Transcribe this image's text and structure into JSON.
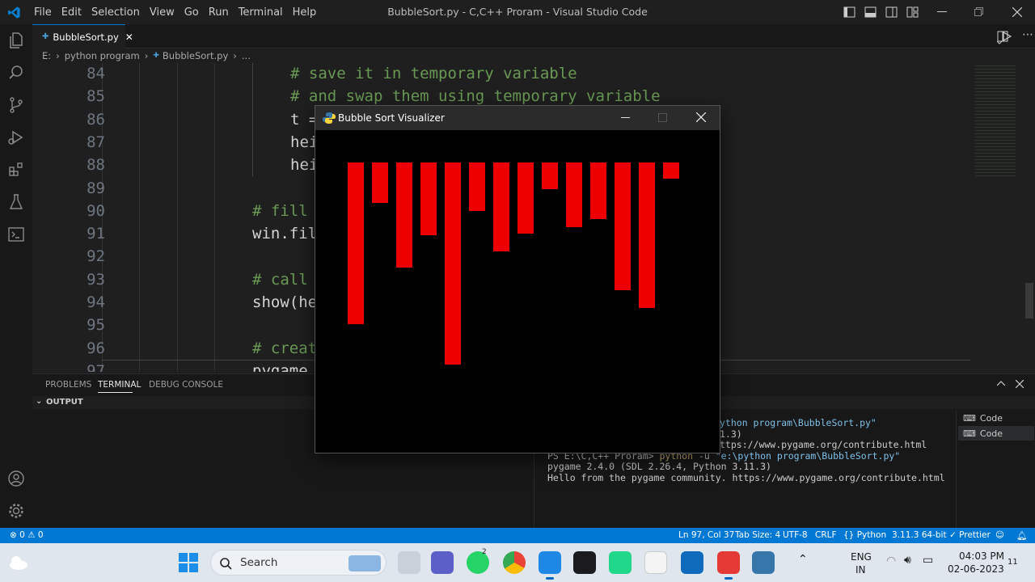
{
  "window": {
    "menu": [
      "File",
      "Edit",
      "Selection",
      "View",
      "Go",
      "Run",
      "Terminal",
      "Help"
    ],
    "title": "BubbleSort.py - C,C++ Proram - Visual Studio Code"
  },
  "tab": {
    "label": "BubbleSort.py"
  },
  "breadcrumb": {
    "drive": "E:",
    "folder": "python program",
    "file": "BubbleSort.py",
    "more": "..."
  },
  "editor": {
    "lines": [
      {
        "num": "84",
        "text": "# save it in temporary variable",
        "comment": true
      },
      {
        "num": "85",
        "text": "# and swap them using temporary variable",
        "comment": true
      },
      {
        "num": "86",
        "text": "t =",
        "comment": false
      },
      {
        "num": "87",
        "text": "hei",
        "comment": false
      },
      {
        "num": "88",
        "text": "hei",
        "comment": false
      },
      {
        "num": "89",
        "text": "",
        "comment": false
      },
      {
        "num": "90",
        "text": "# fill",
        "comment": true
      },
      {
        "num": "91",
        "text": "win.fil",
        "comment": false
      },
      {
        "num": "92",
        "text": "",
        "comment": false
      },
      {
        "num": "93",
        "text": "# call",
        "comment": true
      },
      {
        "num": "94",
        "text": "show(he",
        "comment": false
      },
      {
        "num": "95",
        "text": "",
        "comment": false
      },
      {
        "num": "96",
        "text": "# creat",
        "comment": true
      },
      {
        "num": "97",
        "text": "pygame.",
        "comment": false
      }
    ]
  },
  "panel": {
    "tabs": [
      "PROBLEMS",
      "TERMINAL",
      "DEBUG CONSOLE"
    ],
    "active_tab": "TERMINAL",
    "section": "OUTPUT",
    "terminal_lines": [
      "ython program\\BubbleSort.py\"",
      "1.3)",
      "ttps://www.pygame.org/contribute.html",
      "PS E:\\C,C++ Proram> python -u \"e:\\python program\\BubbleSort.py\"",
      "pygame 2.4.0 (SDL 2.26.4, Python 3.11.3)",
      "Hello from the pygame community. https://www.pygame.org/contribute.html"
    ],
    "terminal_instances": [
      "Code",
      "Code"
    ]
  },
  "statusbar": {
    "errors": "0",
    "warnings": "0",
    "position": "Ln 97, Col 37",
    "tab_size": "Tab Size: 4",
    "encoding": "UTF-8",
    "eol": "CRLF",
    "language": "Python",
    "interpreter": "3.11.3 64-bit",
    "formatter": "Prettier"
  },
  "pygame": {
    "title": "Bubble Sort Visualizer",
    "bar_color": "#ee0000",
    "bar_heights": [
      200,
      50,
      130,
      90,
      250,
      60,
      110,
      88,
      33,
      80,
      70,
      158,
      180,
      20
    ]
  },
  "taskbar": {
    "search_placeholder": "Search",
    "lang_1": "ENG",
    "lang_2": "IN",
    "time": "04:03 PM",
    "date": "02-06-2023",
    "whatsapp_badge": "2",
    "notif": "11"
  },
  "colors": {
    "accent": "#0078d4",
    "comment": "#6a9955"
  }
}
